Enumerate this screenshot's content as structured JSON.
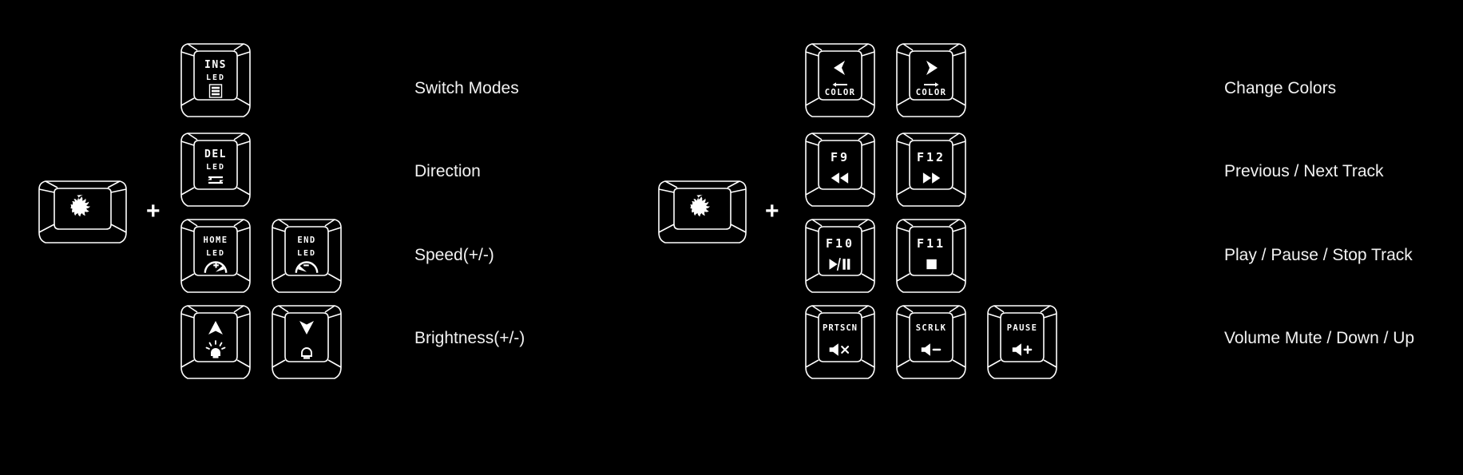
{
  "meta": {
    "background_color": "#000000",
    "key_outline_color": "#ffffff",
    "label_color": "#f2f2f2",
    "plus_symbol": "+"
  },
  "left_group": {
    "modifier_key": {
      "name": "msi-dragon-key",
      "legend": "MSI Dragon Logo"
    },
    "combo_symbol": "+",
    "rows": [
      {
        "description": "Switch Modes",
        "keys": [
          {
            "top": "INS",
            "sub": "LED",
            "glyph": "led-list-icon"
          }
        ]
      },
      {
        "description": "Direction",
        "keys": [
          {
            "top": "DEL",
            "sub": "LED",
            "glyph": "led-direction-icon"
          }
        ]
      },
      {
        "description": "Speed(+/-)",
        "keys": [
          {
            "top": "HOME",
            "sub": "LED",
            "glyph": "speed-up-gauge-icon"
          },
          {
            "top": "END",
            "sub": "LED",
            "glyph": "speed-down-gauge-icon"
          }
        ]
      },
      {
        "description": "Brightness(+/-)",
        "keys": [
          {
            "top": "",
            "sub": "",
            "glyph": "brightness-up-icon"
          },
          {
            "top": "",
            "sub": "",
            "glyph": "brightness-down-icon"
          }
        ]
      }
    ]
  },
  "right_group": {
    "modifier_key": {
      "name": "msi-dragon-key",
      "legend": "MSI Dragon Logo"
    },
    "combo_symbol": "+",
    "rows": [
      {
        "description": "Change Colors",
        "keys": [
          {
            "top": "",
            "sub": "COLOR",
            "glyph": "arrow-left-color-icon"
          },
          {
            "top": "",
            "sub": "COLOR",
            "glyph": "arrow-right-color-icon"
          }
        ]
      },
      {
        "description": "Previous / Next Track",
        "keys": [
          {
            "top": "F9",
            "sub": "",
            "glyph": "rewind-icon"
          },
          {
            "top": "F12",
            "sub": "",
            "glyph": "fast-forward-icon"
          }
        ]
      },
      {
        "description": "Play / Pause / Stop Track",
        "keys": [
          {
            "top": "F10",
            "sub": "",
            "glyph": "play-pause-icon"
          },
          {
            "top": "F11",
            "sub": "",
            "glyph": "stop-icon"
          }
        ]
      },
      {
        "description": "Volume Mute / Down / Up",
        "keys": [
          {
            "top": "PRTSCN",
            "sub": "",
            "glyph": "volume-mute-icon"
          },
          {
            "top": "SCRLK",
            "sub": "",
            "glyph": "volume-down-icon"
          },
          {
            "top": "PAUSE",
            "sub": "",
            "glyph": "volume-up-icon"
          }
        ]
      }
    ]
  }
}
